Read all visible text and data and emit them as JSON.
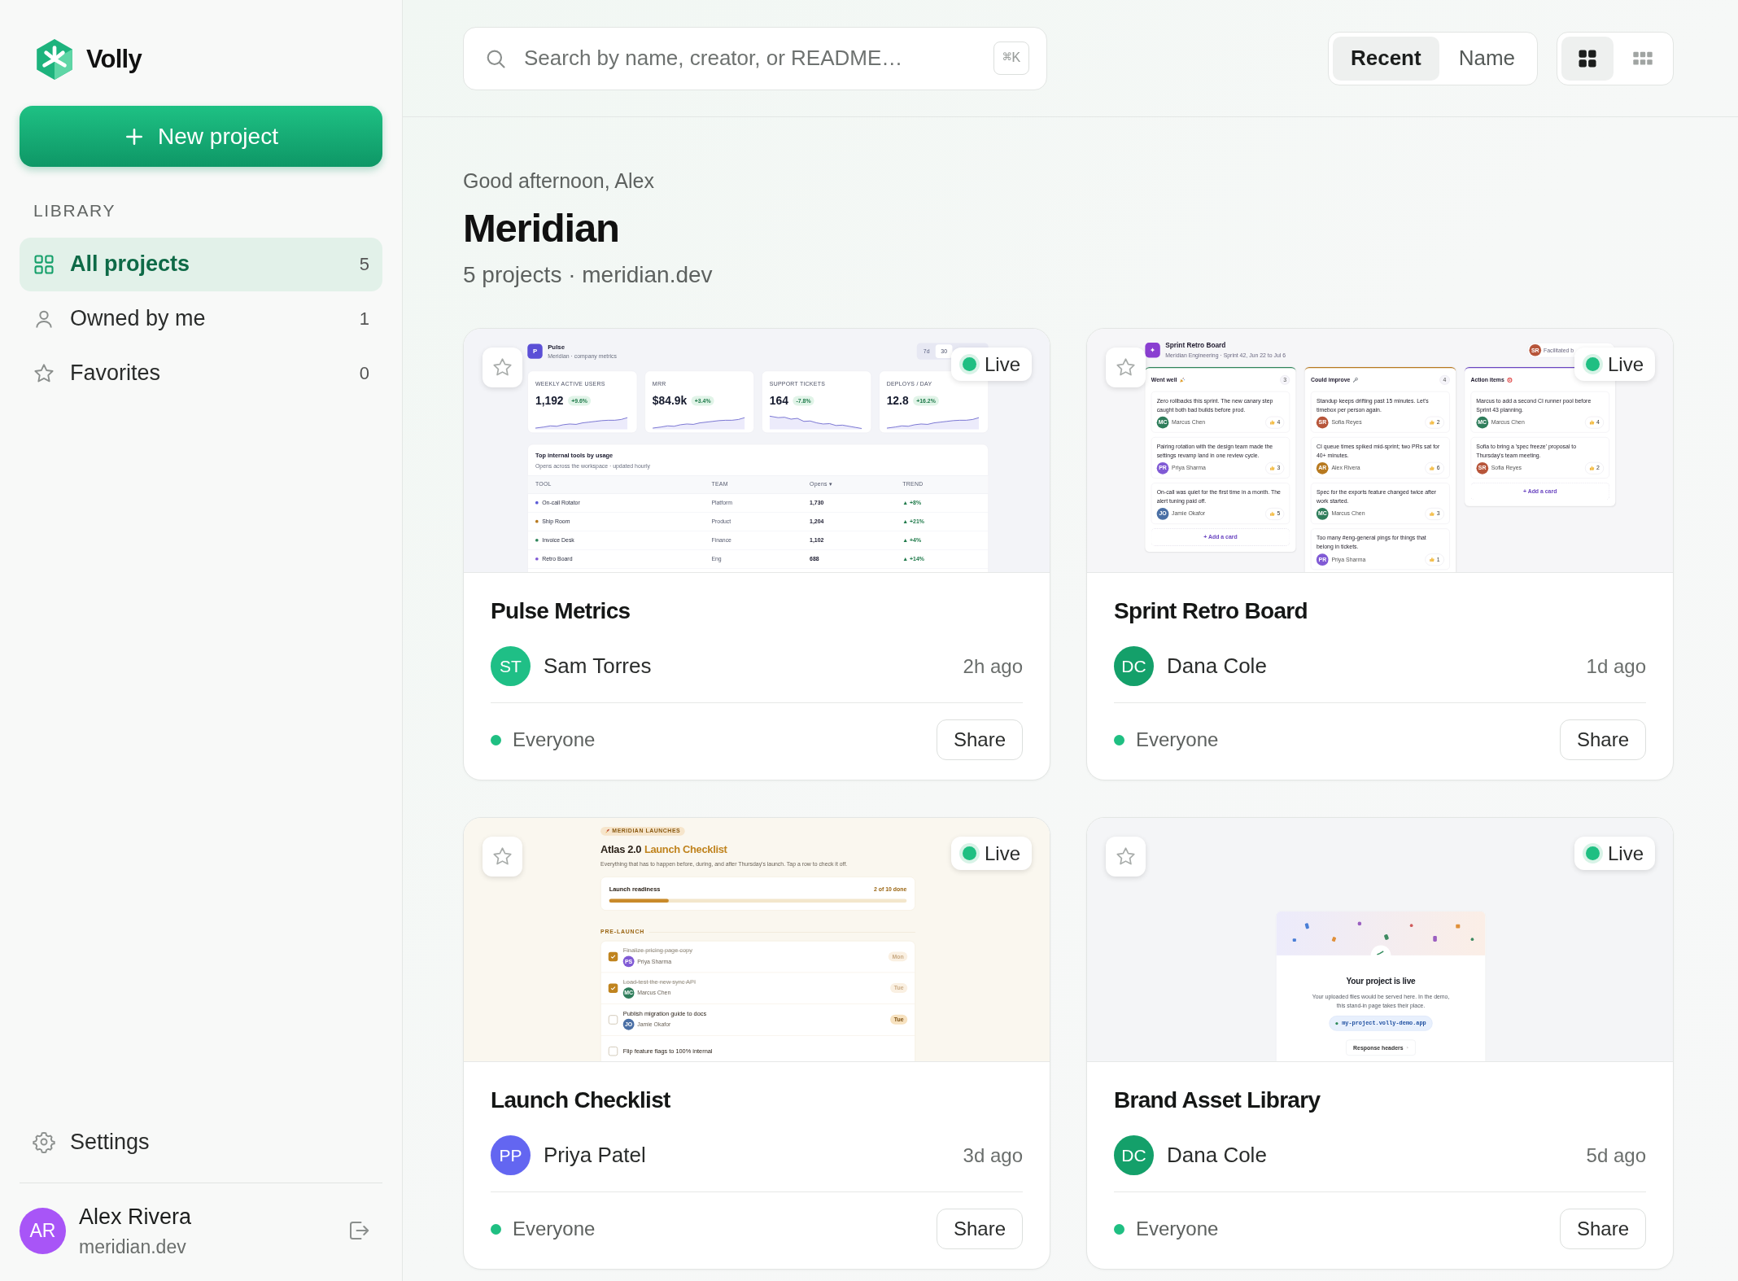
{
  "sidebar": {
    "brand": "Volly",
    "new_project": "New project",
    "section": "LIBRARY",
    "items": [
      {
        "kind": "grid",
        "label": "All projects",
        "count": "5",
        "selected": true
      },
      {
        "kind": "person",
        "label": "Owned by me",
        "count": "1",
        "selected": false
      },
      {
        "kind": "star",
        "label": "Favorites",
        "count": "0",
        "selected": false
      }
    ],
    "settings": "Settings",
    "user": {
      "initials": "AR",
      "name": "Alex Rivera",
      "org": "meridian.dev",
      "color": "#a855f7"
    }
  },
  "search": {
    "placeholder": "Search by name, creator, or README…",
    "shortcut": "⌘K"
  },
  "sort_options": [
    {
      "label": "Recent",
      "selected": true
    },
    {
      "label": "Name",
      "selected": false
    }
  ],
  "view_options": [
    {
      "kind": "large",
      "selected": true
    },
    {
      "kind": "small",
      "selected": false
    }
  ],
  "greeting": "Good afternoon, Alex",
  "title": "Meridian",
  "subtitle": "5 projects · meridian.dev",
  "projects": [
    {
      "title": "Pulse Metrics",
      "favorite": false,
      "status": "Live",
      "creator": {
        "initials": "ST",
        "name": "Sam Torres",
        "color": "#1fbf86"
      },
      "time": "2h ago",
      "visibility": "Everyone",
      "share": "Share",
      "preview": {
        "kind": "dashboard",
        "badge": "P",
        "name": "Pulse",
        "subtitle": "Meridian · company metrics",
        "ranges": [
          {
            "label": "7d",
            "selected": false
          },
          {
            "label": "30",
            "selected": true
          }
        ],
        "metrics": [
          {
            "kind": "rising",
            "label": "WEEKLY ACTIVE USERS",
            "value": "1,192",
            "delta": "+9.6%"
          },
          {
            "kind": "rising",
            "label": "MRR",
            "value": "$84.9k",
            "delta": "+3.4%"
          },
          {
            "kind": "falling",
            "label": "SUPPORT TICKETS",
            "value": "164",
            "delta": "-7.8%"
          },
          {
            "kind": "rising",
            "label": "DEPLOYS / DAY",
            "value": "12.8",
            "delta": "+16.2%"
          }
        ],
        "table_title": "Top internal tools by usage",
        "table_subtitle": "Opens across the workspace · updated hourly",
        "columns": [
          "TOOL",
          "TEAM",
          "Opens ▾",
          "TREND"
        ],
        "rows": [
          {
            "tool": "On-call Rotator",
            "color": "#5b5bd6",
            "team": "Platform",
            "opens": "1,730",
            "trend": "▲ +8%"
          },
          {
            "tool": "Ship Room",
            "color": "#b7791f",
            "team": "Product",
            "opens": "1,204",
            "trend": "▲ +21%"
          },
          {
            "tool": "Invoice Desk",
            "color": "#2f855a",
            "team": "Finance",
            "opens": "1,102",
            "trend": "▲ +4%"
          },
          {
            "tool": "Retro Board",
            "color": "#805ad5",
            "team": "Eng",
            "opens": "688",
            "trend": "▲ +14%"
          }
        ]
      }
    },
    {
      "title": "Sprint Retro Board",
      "favorite": false,
      "status": "Live",
      "creator": {
        "initials": "DC",
        "name": "Dana Cole",
        "color": "#14a06a"
      },
      "time": "1d ago",
      "visibility": "Everyone",
      "share": "Share",
      "preview": {
        "kind": "retro",
        "badge": "✦",
        "name": "Sprint Retro Board",
        "subtitle": "Meridian Engineering · Sprint 42, Jun 22 to Jul 6",
        "facilitator": {
          "initials": "SR",
          "color": "#b7553a",
          "text": "Facilitated b"
        },
        "columns": [
          {
            "kind": "party",
            "title": "Went well",
            "count": "3",
            "color": "#2f855a",
            "add": "+ Add a card",
            "cards": [
              {
                "text": "Zero rollbacks this sprint. The new canary step caught both bad builds before prod.",
                "initials": "MC",
                "author": "Marcus Chen",
                "color": "#2f7d5b",
                "votes": "4"
              },
              {
                "text": "Pairing rotation with the design team made the settings revamp land in one review cycle.",
                "initials": "PR",
                "author": "Priya Sharma",
                "color": "#805ad5",
                "votes": "3"
              },
              {
                "text": "On-call was quiet for the first time in a month. The alert tuning paid off.",
                "initials": "JO",
                "author": "Jamie Okafor",
                "color": "#4a6fa5",
                "votes": "5"
              }
            ]
          },
          {
            "kind": "wrench",
            "title": "Could improve",
            "count": "4",
            "color": "#b7791f",
            "cards": [
              {
                "text": "Standup keeps drifting past 15 minutes. Let's timebox per person again.",
                "initials": "SR",
                "author": "Sofia Reyes",
                "color": "#b7553a",
                "votes": "2"
              },
              {
                "text": "CI queue times spiked mid-sprint; two PRs sat for 40+ minutes.",
                "initials": "AR",
                "author": "Alex Rivera",
                "color": "#b7791f",
                "votes": "6"
              },
              {
                "text": "Spec for the exports feature changed twice after work started.",
                "initials": "MC",
                "author": "Marcus Chen",
                "color": "#2f7d5b",
                "votes": "3"
              },
              {
                "text": "Too many #eng-general pings for things that belong in tickets.",
                "initials": "PR",
                "author": "Priya Sharma",
                "color": "#805ad5",
                "votes": "1"
              }
            ]
          },
          {
            "kind": "target",
            "title": "Action items",
            "color": "#6b46c1",
            "add": "+ Add a card",
            "cards": [
              {
                "text": "Marcus to add a second CI runner pool before Sprint 43 planning.",
                "initials": "MC",
                "author": "Marcus Chen",
                "color": "#2f7d5b",
                "votes": "4"
              },
              {
                "text": "Sofia to bring a 'spec freeze' proposal to Thursday's team meeting.",
                "initials": "SR",
                "author": "Sofia Reyes",
                "color": "#b7553a",
                "votes": "2"
              }
            ]
          }
        ]
      }
    },
    {
      "title": "Launch Checklist",
      "favorite": false,
      "status": "Live",
      "creator": {
        "initials": "PP",
        "name": "Priya Patel",
        "color": "#6366f1"
      },
      "time": "3d ago",
      "visibility": "Everyone",
      "share": "Share",
      "preview": {
        "kind": "checklist",
        "tag": "MERIDIAN LAUNCHES",
        "title": "Atlas 2.0",
        "title_highlight": "Launch Checklist",
        "description": "Everything that has to happen before, during, and after Thursday's launch. Tap a row to check it off.",
        "readiness": {
          "label": "Launch readiness",
          "count": "2 of 10 done",
          "level": 0.2
        },
        "section": "PRE-LAUNCH",
        "items": [
          {
            "title": "Finalize pricing page copy",
            "checked": true,
            "initials": "PS",
            "assignee": "Priya Sharma",
            "color": "#805ad5",
            "day": "Mon"
          },
          {
            "title": "Load-test the new sync API",
            "checked": true,
            "initials": "MC",
            "assignee": "Marcus Chen",
            "color": "#2f7d5b",
            "day": "Tue"
          },
          {
            "title": "Publish migration guide to docs",
            "checked": false,
            "initials": "JO",
            "assignee": "Jamie Okafor",
            "color": "#4a6fa5",
            "day": "Tue"
          },
          {
            "title": "Flip feature flags to 100% internal",
            "checked": false
          }
        ]
      }
    },
    {
      "title": "Brand Asset Library",
      "favorite": false,
      "status": "Live",
      "creator": {
        "initials": "DC",
        "name": "Dana Cole",
        "color": "#14a06a"
      },
      "time": "5d ago",
      "visibility": "Everyone",
      "share": "Share",
      "preview": {
        "kind": "site",
        "title": "Your project is live",
        "text": "Your uploaded files would be served here. In the demo, this stand-in page takes their place.",
        "url": "my-project.volly-demo.app",
        "button": "Response headers"
      }
    }
  ]
}
